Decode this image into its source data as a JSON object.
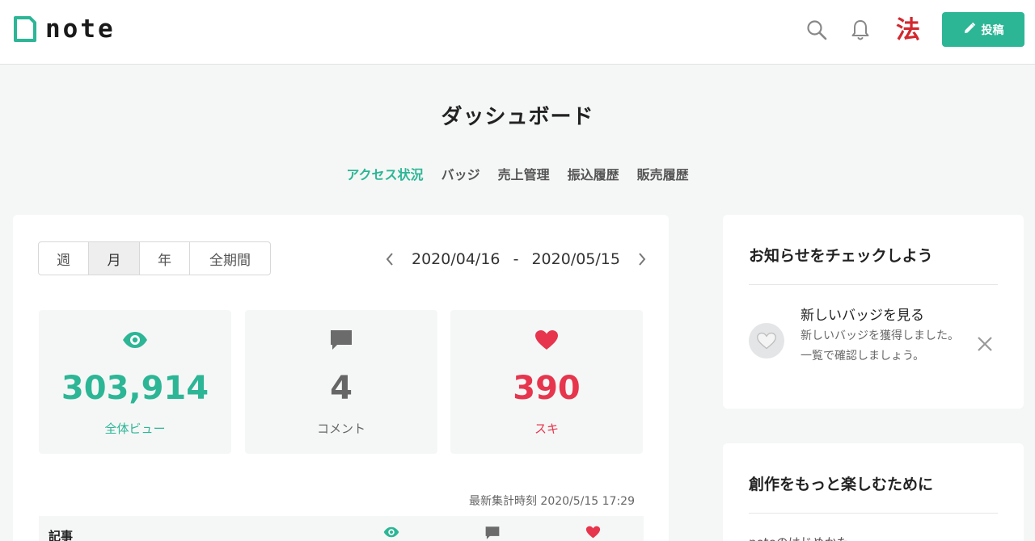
{
  "header": {
    "logo_text": "note",
    "avatar_char": "法",
    "post_label": "投稿"
  },
  "page": {
    "title": "ダッシュボード",
    "tabs": [
      {
        "label": "アクセス状況",
        "active": true
      },
      {
        "label": "バッジ",
        "active": false
      },
      {
        "label": "売上管理",
        "active": false
      },
      {
        "label": "振込履歴",
        "active": false
      },
      {
        "label": "販売履歴",
        "active": false
      }
    ]
  },
  "main": {
    "periods": [
      {
        "label": "週",
        "active": false
      },
      {
        "label": "月",
        "active": true
      },
      {
        "label": "年",
        "active": false
      },
      {
        "label": "全期間",
        "active": false
      }
    ],
    "date_start": "2020/04/16",
    "date_sep": "-",
    "date_end": "2020/05/15",
    "stats": [
      {
        "value": "303,914",
        "label": "全体ビュー",
        "color": "#2cb696",
        "icon": "eye-icon"
      },
      {
        "value": "4",
        "label": "コメント",
        "color": "#666666",
        "icon": "comment-icon"
      },
      {
        "value": "390",
        "label": "スキ",
        "color": "#e6354d",
        "icon": "heart-icon"
      }
    ],
    "updated": "最新集計時刻 2020/5/15 17:29",
    "table_header": "記事"
  },
  "side": {
    "notice_title": "お知らせをチェックしよう",
    "notice_item_title": "新しいバッジを見る",
    "notice_item_body": "新しいバッジを獲得しました。一覧で確認しましょう。",
    "creation_title": "創作をもっと楽しむために",
    "creation_sub": "noteのはじめかた"
  },
  "colors": {
    "accent": "#2cb696",
    "like": "#e6354d"
  }
}
